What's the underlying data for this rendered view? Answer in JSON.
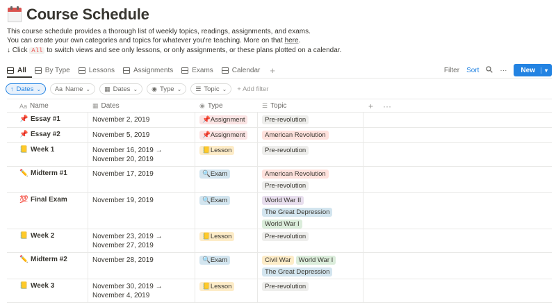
{
  "page": {
    "title": "Course Schedule",
    "icon": "calendar-icon",
    "description_1": "This course schedule provides a thorough list of weekly topics, readings, assignments, and exams.",
    "description_2_prefix": "You can create your own categories and topics for whatever you're teaching. More on that ",
    "description_2_link": "here",
    "description_2_suffix": ".",
    "description_3_prefix": "↓ Click ",
    "description_3_code": "All",
    "description_3_suffix": " to switch views and see only lessons, or only assignments, or these plans plotted on a calendar."
  },
  "views": {
    "tabs": [
      {
        "label": "All"
      },
      {
        "label": "By Type"
      },
      {
        "label": "Lessons"
      },
      {
        "label": "Assignments"
      },
      {
        "label": "Exams"
      },
      {
        "label": "Calendar"
      }
    ],
    "add": "+",
    "filter_label": "Filter",
    "sort_label": "Sort",
    "more_label": "···",
    "new_label": "New",
    "new_caret": "▾"
  },
  "filters": {
    "sort_chip": "Dates",
    "chips": [
      {
        "icon": "Aa",
        "label": "Name"
      },
      {
        "icon": "▦",
        "label": "Dates"
      },
      {
        "icon": "◉",
        "label": "Type"
      },
      {
        "icon": "☰",
        "label": "Topic"
      }
    ],
    "add_filter": "+ Add filter"
  },
  "table": {
    "headers": {
      "name": "Name",
      "dates": "Dates",
      "type": "Type",
      "topic": "Topic",
      "add": "+",
      "more": "···"
    },
    "rows": [
      {
        "emoji": "📌",
        "name": "Essay #1",
        "dates": "November 2, 2019",
        "type": "📌Assignment",
        "type_kind": "assignment",
        "topics": [
          [
            "Pre-revolution"
          ]
        ]
      },
      {
        "emoji": "📌",
        "name": "Essay #2",
        "dates": "November 5, 2019",
        "type": "📌Assignment",
        "type_kind": "assignment",
        "topics": [
          [
            "American Revolution"
          ]
        ]
      },
      {
        "emoji": "📒",
        "name": "Week 1",
        "dates": "November 16, 2019 → November 20, 2019",
        "type": "📒Lesson",
        "type_kind": "lesson",
        "topics": [
          [
            "Pre-revolution"
          ]
        ]
      },
      {
        "emoji": "✏️",
        "name": "Midterm #1",
        "dates": "November 17, 2019",
        "type": "🔍Exam",
        "type_kind": "exam",
        "topics": [
          [
            "American Revolution"
          ],
          [
            "Pre-revolution"
          ]
        ]
      },
      {
        "emoji": "💯",
        "name": "Final Exam",
        "dates": "November 19, 2019",
        "type": "🔍Exam",
        "type_kind": "exam",
        "topics": [
          [
            "World War II"
          ],
          [
            "The Great Depression"
          ],
          [
            "World War I"
          ]
        ]
      },
      {
        "emoji": "📒",
        "name": "Week 2",
        "dates": "November 23, 2019 → November 27, 2019",
        "type": "📒Lesson",
        "type_kind": "lesson",
        "topics": [
          [
            "Pre-revolution"
          ]
        ]
      },
      {
        "emoji": "✏️",
        "name": "Midterm #2",
        "dates": "November 28, 2019",
        "type": "🔍Exam",
        "type_kind": "exam",
        "topics": [
          [
            "Civil War",
            "World War I"
          ],
          [
            "The Great Depression"
          ]
        ]
      },
      {
        "emoji": "📒",
        "name": "Week 3",
        "dates": "November 30, 2019 → November 4, 2019",
        "type": "📒Lesson",
        "type_kind": "lesson",
        "topics": [
          [
            "Pre-revolution"
          ]
        ]
      }
    ]
  },
  "colors": {
    "accent": "#2383e2",
    "tag_assignment": "#fbe4e4",
    "tag_lesson": "#fdecc8",
    "tag_exam": "#d3e5ef",
    "topic_Pre-revolution": "#eeeeec",
    "topic_American Revolution": "#ffe2dd",
    "topic_World War II": "#e8deee",
    "topic_The Great Depression": "#d3e5ef",
    "topic_World War I": "#dbeddb",
    "topic_Civil War": "#fdecc8"
  }
}
